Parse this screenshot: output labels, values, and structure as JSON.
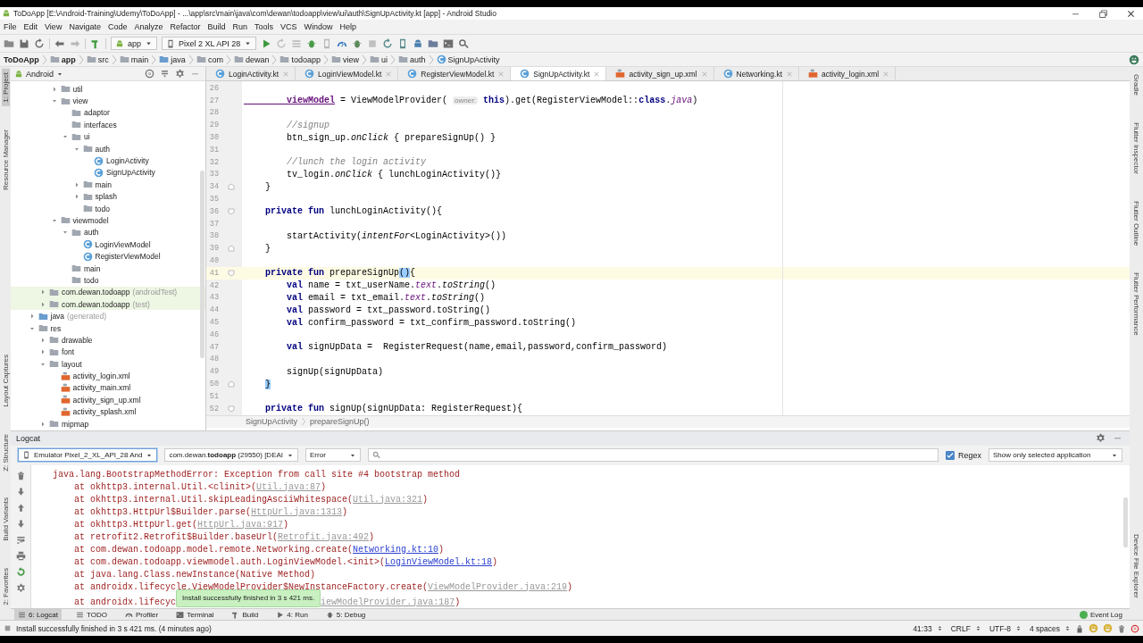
{
  "window": {
    "title": "ToDoApp [E:\\Android-Training\\Udemy\\ToDoApp] - ...\\app\\src\\main\\java\\com\\dewan\\todoapp\\view\\ui\\auth\\SignUpActivity.kt [app] - Android Studio"
  },
  "menu": [
    "File",
    "Edit",
    "View",
    "Navigate",
    "Code",
    "Analyze",
    "Refactor",
    "Build",
    "Run",
    "Tools",
    "VCS",
    "Window",
    "Help"
  ],
  "toolbar": {
    "run_config": "app",
    "device": "Pixel 2 XL API 28"
  },
  "breadcrumb": [
    {
      "label": "ToDoApp",
      "kind": "project"
    },
    {
      "label": "app",
      "kind": "module"
    },
    {
      "label": "src",
      "kind": "folder"
    },
    {
      "label": "main",
      "kind": "folder"
    },
    {
      "label": "java",
      "kind": "source-folder"
    },
    {
      "label": "com",
      "kind": "folder"
    },
    {
      "label": "dewan",
      "kind": "folder"
    },
    {
      "label": "todoapp",
      "kind": "folder"
    },
    {
      "label": "view",
      "kind": "folder"
    },
    {
      "label": "ui",
      "kind": "folder"
    },
    {
      "label": "auth",
      "kind": "folder"
    },
    {
      "label": "SignUpActivity",
      "kind": "class"
    }
  ],
  "left_tool_windows_top": [
    {
      "label": "1: Project",
      "selected": true
    },
    {
      "label": "Resource Manager",
      "selected": false
    }
  ],
  "left_tool_windows_bottom": [
    {
      "label": "Layout Captures",
      "selected": false
    },
    {
      "label": "Z: Structure",
      "selected": false
    },
    {
      "label": "Build Variants",
      "selected": false
    },
    {
      "label": "2: Favorites",
      "selected": false
    }
  ],
  "right_tool_windows_top": [
    {
      "label": "Gradle",
      "selected": false
    },
    {
      "label": "Flutter Inspector",
      "selected": false
    },
    {
      "label": "Flutter Outline",
      "selected": false
    },
    {
      "label": "Flutter Performance",
      "selected": false
    }
  ],
  "right_tool_windows_bottom": [
    {
      "label": "Device File Explorer",
      "selected": false
    }
  ],
  "project": {
    "view": "Android",
    "tree": [
      {
        "children": [
          {
            "children": [
              {
                "label": "util",
                "kind": "folder",
                "expanded": false
              },
              {
                "label": "view",
                "kind": "folder",
                "expanded": true,
                "children": [
                  {
                    "label": "adaptor",
                    "kind": "folder"
                  },
                  {
                    "label": "interfaces",
                    "kind": "folder"
                  },
                  {
                    "label": "ui",
                    "kind": "folder",
                    "expanded": true,
                    "children": [
                      {
                        "label": "auth",
                        "kind": "folder",
                        "expanded": true,
                        "children": [
                          {
                            "label": "LoginActivity",
                            "kind": "class"
                          },
                          {
                            "label": "SignUpActivity",
                            "kind": "class"
                          }
                        ]
                      },
                      {
                        "label": "main",
                        "kind": "folder",
                        "expanded": false
                      },
                      {
                        "label": "splash",
                        "kind": "folder",
                        "expanded": false
                      },
                      {
                        "label": "todo",
                        "kind": "folder"
                      }
                    ]
                  }
                ]
              },
              {
                "label": "viewmodel",
                "kind": "folder",
                "expanded": true,
                "children": [
                  {
                    "label": "auth",
                    "kind": "folder",
                    "expanded": true,
                    "children": [
                      {
                        "label": "LoginViewModel",
                        "kind": "class"
                      },
                      {
                        "label": "RegisterViewModel",
                        "kind": "class"
                      }
                    ]
                  },
                  {
                    "label": "main",
                    "kind": "folder"
                  },
                  {
                    "label": "todo",
                    "kind": "folder"
                  }
                ]
              }
            ]
          },
          {
            "label": "com.dewan.todoapp",
            "secondary": "(androidTest)",
            "kind": "test-package",
            "expanded": false
          },
          {
            "label": "com.dewan.todoapp",
            "secondary": "(test)",
            "kind": "test-package",
            "expanded": false
          }
        ]
      },
      {
        "label": "java",
        "secondary": "(generated)",
        "kind": "generated",
        "expanded": false
      },
      {
        "label": "res",
        "kind": "res-folder",
        "expanded": true,
        "children": [
          {
            "label": "drawable",
            "kind": "folder",
            "expanded": false
          },
          {
            "label": "font",
            "kind": "folder",
            "expanded": false
          },
          {
            "label": "layout",
            "kind": "folder",
            "expanded": true,
            "children": [
              {
                "label": "activity_login.xml",
                "kind": "layout-file"
              },
              {
                "label": "activity_main.xml",
                "kind": "layout-file"
              },
              {
                "label": "activity_sign_up.xml",
                "kind": "layout-file"
              },
              {
                "label": "activity_splash.xml",
                "kind": "layout-file"
              }
            ]
          },
          {
            "label": "mipmap",
            "kind": "folder",
            "expanded": false
          }
        ]
      }
    ]
  },
  "editor": {
    "tabs": [
      {
        "label": "LoginActivity.kt",
        "kind": "kotlin",
        "selected": false
      },
      {
        "label": "LoginViewModel.kt",
        "kind": "kotlin",
        "selected": false
      },
      {
        "label": "RegisterViewModel.kt",
        "kind": "kotlin",
        "selected": false
      },
      {
        "label": "SignUpActivity.kt",
        "kind": "kotlin",
        "selected": true
      },
      {
        "label": "activity_sign_up.xml",
        "kind": "xml",
        "selected": false
      },
      {
        "label": "Networking.kt",
        "kind": "kotlin",
        "selected": false
      },
      {
        "label": "activity_login.xml",
        "kind": "xml",
        "selected": false
      }
    ],
    "lines": [
      {
        "number": "26",
        "current": false
      },
      {
        "number": "27",
        "current": false,
        "segments": [
          {
            "text": "        viewModel",
            "kind": "field"
          },
          {
            "text": " = ViewModelProvider( ",
            "kind": "plain"
          },
          {
            "text": "owner:",
            "kind": "hint"
          },
          {
            "text": " this",
            "kind": "kw"
          },
          {
            "text": ").get(RegisterViewModel::",
            "kind": "plain"
          },
          {
            "text": "class",
            "kind": "kw"
          },
          {
            "text": ".",
            "kind": "plain"
          },
          {
            "text": "java",
            "kind": "prop"
          },
          {
            "text": ")",
            "kind": "plain"
          }
        ]
      },
      {
        "number": "28",
        "current": false
      },
      {
        "number": "29",
        "current": false,
        "segments": [
          {
            "text": "        //signup",
            "kind": "comment"
          }
        ]
      },
      {
        "number": "30",
        "current": false,
        "segments": [
          {
            "text": "        btn_sign_up.",
            "kind": "plain"
          },
          {
            "text": "onClick",
            "kind": "call"
          },
          {
            "text": " { prepareSignUp() }",
            "kind": "plain"
          }
        ]
      },
      {
        "number": "31",
        "current": false
      },
      {
        "number": "32",
        "current": false,
        "segments": [
          {
            "text": "        //lunch the login activity",
            "kind": "comment"
          }
        ]
      },
      {
        "number": "33",
        "current": false,
        "segments": [
          {
            "text": "        tv_login.",
            "kind": "plain"
          },
          {
            "text": "onClick",
            "kind": "call"
          },
          {
            "text": " { lunchLoginActivity()}",
            "kind": "plain"
          }
        ]
      },
      {
        "number": "34",
        "current": false,
        "fold_end": true,
        "segments": [
          {
            "text": "    }",
            "kind": "plain"
          }
        ]
      },
      {
        "number": "35",
        "current": false
      },
      {
        "number": "36",
        "current": false,
        "fold_start": true,
        "segments": [
          {
            "text": "    private fun",
            "kind": "kw"
          },
          {
            "text": " lunchLoginActivity(){",
            "kind": "plain"
          }
        ]
      },
      {
        "number": "37",
        "current": false
      },
      {
        "number": "38",
        "current": false,
        "segments": [
          {
            "text": "        startActivity(",
            "kind": "plain"
          },
          {
            "text": "intentFor",
            "kind": "call"
          },
          {
            "text": "<LoginActivity>())",
            "kind": "plain"
          }
        ]
      },
      {
        "number": "39",
        "current": false,
        "fold_end": true,
        "segments": [
          {
            "text": "    }",
            "kind": "plain"
          }
        ]
      },
      {
        "number": "40",
        "current": false
      },
      {
        "number": "41",
        "current": true,
        "fold_start": true,
        "segments": [
          {
            "text": "    private fun",
            "kind": "kw"
          },
          {
            "text": " prepareSignUp",
            "kind": "plain"
          },
          {
            "text": "()",
            "kind": "match"
          },
          {
            "text": "{",
            "kind": "plain"
          }
        ]
      },
      {
        "number": "42",
        "current": false,
        "segments": [
          {
            "text": "        val",
            "kind": "kw"
          },
          {
            "text": " name = txt_userName.",
            "kind": "plain"
          },
          {
            "text": "text",
            "kind": "prop"
          },
          {
            "text": ".",
            "kind": "plain"
          },
          {
            "text": "toString",
            "kind": "call"
          },
          {
            "text": "()",
            "kind": "plain"
          }
        ]
      },
      {
        "number": "43",
        "current": false,
        "segments": [
          {
            "text": "        val",
            "kind": "kw"
          },
          {
            "text": " email = txt_email.",
            "kind": "plain"
          },
          {
            "text": "text",
            "kind": "prop"
          },
          {
            "text": ".",
            "kind": "plain"
          },
          {
            "text": "toString",
            "kind": "call"
          },
          {
            "text": "()",
            "kind": "plain"
          }
        ]
      },
      {
        "number": "44",
        "current": false,
        "segments": [
          {
            "text": "        val",
            "kind": "kw"
          },
          {
            "text": " password = txt_password.toString()",
            "kind": "plain"
          }
        ]
      },
      {
        "number": "45",
        "current": false,
        "segments": [
          {
            "text": "        val",
            "kind": "kw"
          },
          {
            "text": " confirm_password = txt_confirm_password.toString()",
            "kind": "plain"
          }
        ]
      },
      {
        "number": "46",
        "current": false
      },
      {
        "number": "47",
        "current": false,
        "segments": [
          {
            "text": "        val",
            "kind": "kw"
          },
          {
            "text": " signUpData =  RegisterRequest(name,email,password,confirm_password)",
            "kind": "plain"
          }
        ]
      },
      {
        "number": "48",
        "current": false
      },
      {
        "number": "49",
        "current": false,
        "segments": [
          {
            "text": "        signUp(signUpData)",
            "kind": "plain"
          }
        ]
      },
      {
        "number": "50",
        "current": false,
        "fold_end": true,
        "segments": [
          {
            "text": "    }",
            "kind": "match-end"
          }
        ]
      },
      {
        "number": "51",
        "current": false
      },
      {
        "number": "52",
        "current": false,
        "fold_start": true,
        "segments": [
          {
            "text": "    private fun",
            "kind": "kw"
          },
          {
            "text": " signUp(signUpData: RegisterRequest){",
            "kind": "plain"
          }
        ]
      }
    ],
    "breadcrumb": [
      "SignUpActivity",
      "prepareSignUp()"
    ]
  },
  "logcat": {
    "title": "Logcat",
    "device": "Emulator Pixel_2_XL_API_28 And",
    "process": "com.dewan.**todoapp** (29550) [DEAI",
    "level": "Error",
    "regex": {
      "label": "Regex",
      "checked": true
    },
    "filter": "Show only selected application",
    "lines": [
      [
        {
          "text": "java.lang.BootstrapMethodError: Exception from call site #4 bootstrap method",
          "kind": "text"
        }
      ],
      [
        {
          "text": "    at okhttp3.internal.Util.<clinit>(",
          "kind": "text"
        },
        {
          "text": "Util.java:87",
          "kind": "link"
        },
        {
          "text": ")",
          "kind": "text"
        }
      ],
      [
        {
          "text": "    at okhttp3.internal.Util.skipLeadingAsciiWhitespace(",
          "kind": "text"
        },
        {
          "text": "Util.java:321",
          "kind": "link"
        },
        {
          "text": ")",
          "kind": "text"
        }
      ],
      [
        {
          "text": "    at okhttp3.HttpUrl$Builder.parse(",
          "kind": "text"
        },
        {
          "text": "HttpUrl.java:1313",
          "kind": "link"
        },
        {
          "text": ")",
          "kind": "text"
        }
      ],
      [
        {
          "text": "    at okhttp3.HttpUrl.get(",
          "kind": "text"
        },
        {
          "text": "HttpUrl.java:917",
          "kind": "link"
        },
        {
          "text": ")",
          "kind": "text"
        }
      ],
      [
        {
          "text": "    at retrofit2.Retrofit$Builder.baseUrl(",
          "kind": "text"
        },
        {
          "text": "Retrofit.java:492",
          "kind": "link"
        },
        {
          "text": ")",
          "kind": "text"
        }
      ],
      [
        {
          "text": "    at com.dewan.todoapp.model.remote.Networking.create(",
          "kind": "text"
        },
        {
          "text": "Networking.kt:10",
          "kind": "source"
        },
        {
          "text": ")",
          "kind": "text"
        }
      ],
      [
        {
          "text": "    at com.dewan.todoapp.viewmodel.auth.LoginViewModel.<init>(",
          "kind": "text"
        },
        {
          "text": "LoginViewModel.kt:18",
          "kind": "source"
        },
        {
          "text": ")",
          "kind": "text"
        }
      ],
      [
        {
          "text": "    at java.lang.Class.newInstance(Native Method)",
          "kind": "text"
        }
      ],
      [
        {
          "text": "    at androidx.lifecycle.ViewModelProvider$NewInstanceFactory.create(",
          "kind": "text"
        },
        {
          "text": "ViewModelProvider.java:219",
          "kind": "link"
        },
        {
          "text": ")",
          "kind": "text"
        }
      ],
      [
        {
          "text": "    at androidx.lifecyc",
          "kind": "text"
        },
        {
          "text": "Install successfully finished in 3 s 421 ms.",
          "kind": "toast"
        },
        {
          "text": "iewModelProvider.java:187",
          "kind": "link"
        },
        {
          "text": ")",
          "kind": "text"
        }
      ]
    ]
  },
  "tool_tabs": [
    {
      "label": "6: Logcat",
      "kind": "logcat",
      "selected": true
    },
    {
      "label": "TODO",
      "kind": "todo",
      "selected": false
    },
    {
      "label": "Profiler",
      "kind": "profiler",
      "selected": false
    },
    {
      "label": "Terminal",
      "kind": "terminal",
      "selected": false
    },
    {
      "label": "Build",
      "kind": "build",
      "selected": false
    },
    {
      "label": "4: Run",
      "kind": "run",
      "selected": false
    },
    {
      "label": "5: Debug",
      "kind": "debug",
      "selected": false
    }
  ],
  "event_log": "Event Log",
  "status_bar": {
    "message": "Install successfully finished in 3 s 421 ms. (4 minutes ago)",
    "items": [
      "41:33",
      "CRLF",
      "UTF-8",
      "4 spaces"
    ]
  }
}
